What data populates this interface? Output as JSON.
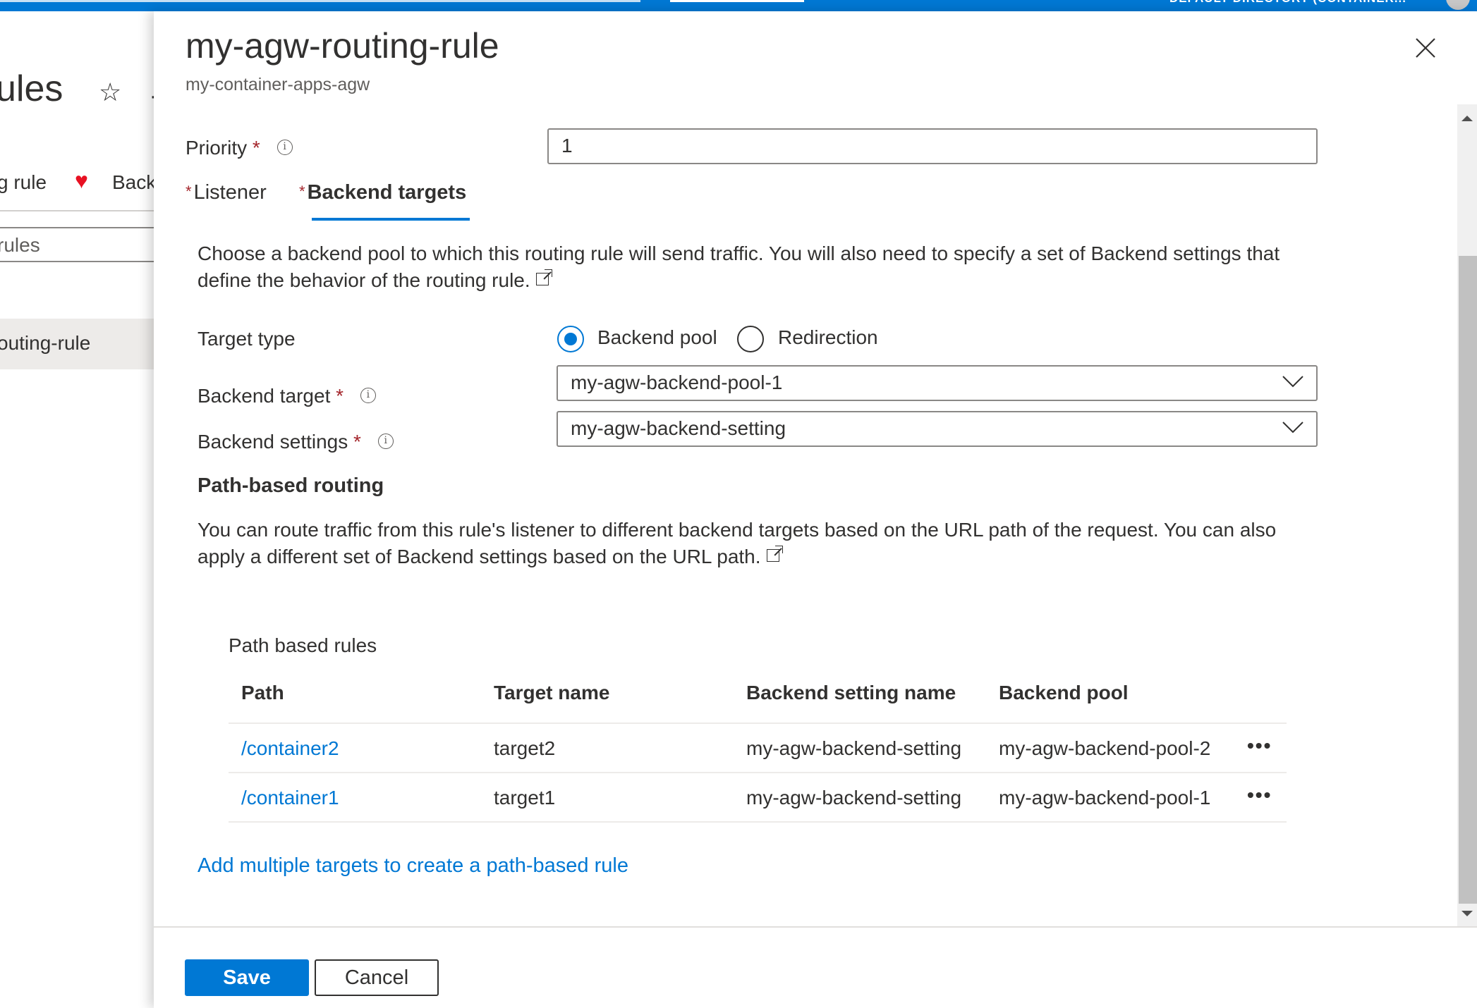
{
  "topbar": {
    "directory_label": "DEFAULT DIRECTORY (CONTAINER..."
  },
  "background_blade": {
    "title_fragment": "ules",
    "command_1_fragment": "g rule",
    "command_2_fragment": "Back",
    "filter_placeholder_fragment": "rules",
    "selected_row_fragment": "outing-rule"
  },
  "panel": {
    "title": "my-agw-routing-rule",
    "subtitle": "my-container-apps-agw",
    "close_icon": "close-icon"
  },
  "priority": {
    "label": "Priority",
    "required_mark": "*",
    "info_glyph": "i",
    "value": "1"
  },
  "tabs": [
    {
      "label": "Listener",
      "required_mark": "*",
      "active": false
    },
    {
      "label": "Backend targets",
      "required_mark": "*",
      "active": true
    }
  ],
  "backend_targets": {
    "description": "Choose a backend pool to which this routing rule will send traffic. You will also need to specify a set of Backend settings that define the behavior of the routing rule.",
    "target_type": {
      "label": "Target type",
      "options": [
        {
          "label": "Backend pool",
          "selected": true
        },
        {
          "label": "Redirection",
          "selected": false
        }
      ]
    },
    "backend_target": {
      "label": "Backend target",
      "required_mark": "*",
      "value": "my-agw-backend-pool-1"
    },
    "backend_settings": {
      "label": "Backend settings",
      "required_mark": "*",
      "value": "my-agw-backend-setting"
    }
  },
  "path_routing": {
    "heading": "Path-based routing",
    "description": "You can route traffic from this rule's listener to different backend targets based on the URL path of the request. You can also apply a different set of Backend settings based on the URL path.",
    "table_title": "Path based rules",
    "columns": [
      "Path",
      "Target name",
      "Backend setting name",
      "Backend pool"
    ],
    "rows": [
      {
        "path": "/container2",
        "target_name": "target2",
        "backend_setting": "my-agw-backend-setting",
        "backend_pool": "my-agw-backend-pool-2",
        "more": "•••"
      },
      {
        "path": "/container1",
        "target_name": "target1",
        "backend_setting": "my-agw-backend-setting",
        "backend_pool": "my-agw-backend-pool-1",
        "more": "•••"
      }
    ],
    "add_link": "Add multiple targets to create a path-based rule"
  },
  "footer": {
    "save_label": "Save",
    "cancel_label": "Cancel"
  },
  "colors": {
    "accent": "#0078d4",
    "required": "#a4262c",
    "text": "#323130"
  }
}
